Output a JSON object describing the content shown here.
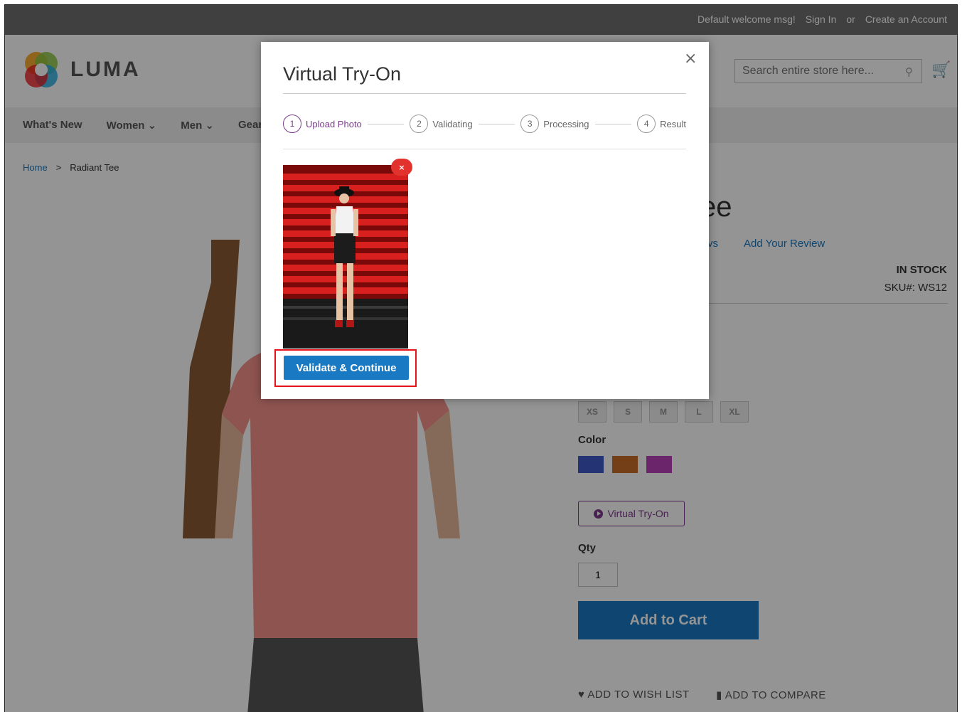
{
  "header": {
    "welcome": "Default welcome msg!",
    "sign_in": "Sign In",
    "or": "or",
    "create_account": "Create an Account"
  },
  "logo": {
    "text": "LUMA"
  },
  "search": {
    "placeholder": "Search entire store here..."
  },
  "nav": {
    "items": [
      "What's New",
      "Women",
      "Men",
      "Gear"
    ]
  },
  "breadcrumb": {
    "home": "Home",
    "separator": ">",
    "current": "Radiant Tee"
  },
  "product": {
    "title_partial": "ee",
    "reviews_partial": "vs",
    "add_review": "Add Your Review",
    "stock": "IN STOCK",
    "sku": "SKU#:  WS12",
    "sizes": [
      "XS",
      "S",
      "M",
      "L",
      "XL"
    ],
    "color_label": "Color",
    "colors": [
      "#3f59c8",
      "#c86b28",
      "#b941b9"
    ],
    "tryon_label": "Virtual Try-On",
    "qty_label": "Qty",
    "qty_value": "1",
    "add_to_cart": "Add to Cart",
    "wish_list": "ADD TO WISH LIST",
    "compare": "ADD TO COMPARE"
  },
  "modal": {
    "title": "Virtual Try-On",
    "close": "×",
    "steps": [
      {
        "num": "1",
        "label": "Upload Photo"
      },
      {
        "num": "2",
        "label": "Validating"
      },
      {
        "num": "3",
        "label": "Processing"
      },
      {
        "num": "4",
        "label": "Result"
      }
    ],
    "remove": "×",
    "validate_label": "Validate & Continue"
  }
}
